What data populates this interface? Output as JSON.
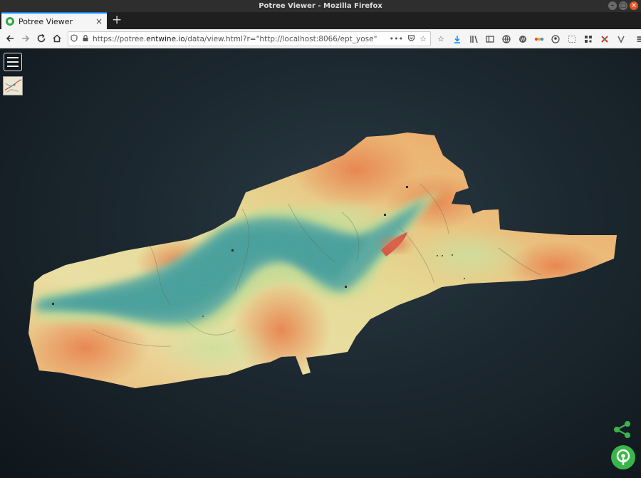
{
  "window": {
    "title": "Potree Viewer - Mozilla Firefox"
  },
  "tab": {
    "label": "Potree Viewer",
    "close": "×",
    "new_tab": "+"
  },
  "url": {
    "prefix": "https://potree.",
    "domain": "entwine.io",
    "suffix": "/data/view.html?r=\"http://localhost:8066/ept_yose\""
  },
  "icons": {
    "back": "back-arrow-icon",
    "forward": "forward-arrow-icon",
    "reload": "reload-icon",
    "home": "home-icon",
    "menu": "hamburger-menu-icon",
    "share": "share-icon",
    "logo": "potree-logo-icon"
  },
  "colors": {
    "low": "#3f9e9a",
    "mid": "#d8e39a",
    "high": "#ee8a4f",
    "peak": "#d94a3a",
    "accent": "#3ab54a"
  }
}
